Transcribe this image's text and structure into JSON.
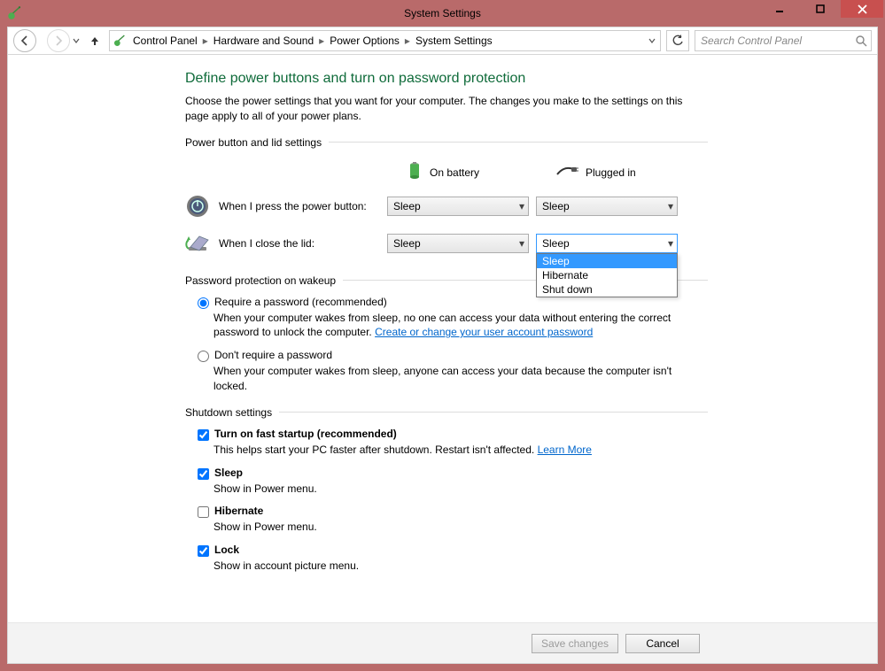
{
  "window": {
    "title": "System Settings"
  },
  "breadcrumbs": {
    "root": "Control Panel",
    "level1": "Hardware and Sound",
    "level2": "Power Options",
    "level3": "System Settings"
  },
  "search": {
    "placeholder": "Search Control Panel"
  },
  "page": {
    "title": "Define power buttons and turn on password protection",
    "description": "Choose the power settings that you want for your computer. The changes you make to the settings on this page apply to all of your power plans."
  },
  "group_power": {
    "header": "Power button and lid settings",
    "col_battery": "On battery",
    "col_plugged": "Plugged in",
    "row_power_label": "When I press the power button:",
    "row_lid_label": "When I close the lid:",
    "power_battery_value": "Sleep",
    "power_plugged_value": "Sleep",
    "lid_battery_value": "Sleep",
    "lid_plugged_value": "Sleep",
    "options": {
      "opt1": "Sleep",
      "opt2": "Hibernate",
      "opt3": "Shut down"
    }
  },
  "group_password": {
    "header": "Password protection on wakeup",
    "opt_require_label": "Require a password (recommended)",
    "opt_require_desc_prefix": "When your computer wakes from sleep, no one can access your data without entering the correct password to unlock the computer. ",
    "opt_require_link": "Create or change your user account password",
    "opt_norequire_label": "Don't require a password",
    "opt_norequire_desc": "When your computer wakes from sleep, anyone can access your data because the computer isn't locked."
  },
  "group_shutdown": {
    "header": "Shutdown settings",
    "fast_label": "Turn on fast startup (recommended)",
    "fast_desc_prefix": "This helps start your PC faster after shutdown. Restart isn't affected. ",
    "fast_link": "Learn More",
    "sleep_label": "Sleep",
    "sleep_desc": "Show in Power menu.",
    "hibernate_label": "Hibernate",
    "hibernate_desc": "Show in Power menu.",
    "lock_label": "Lock",
    "lock_desc": "Show in account picture menu."
  },
  "footer": {
    "save": "Save changes",
    "cancel": "Cancel"
  }
}
